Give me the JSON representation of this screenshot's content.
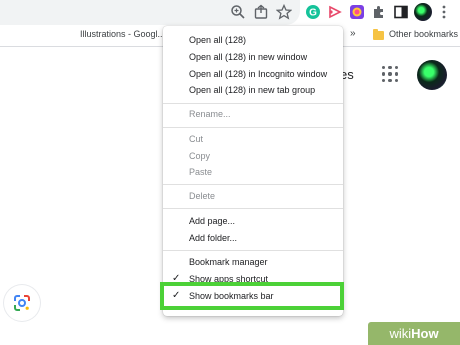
{
  "toolbar": {
    "icons": [
      "zoom-icon",
      "share-icon",
      "star-icon",
      "grammarly-extension-icon",
      "cast-extension-icon",
      "color-extension-icon",
      "extensions-puzzle-icon",
      "sidepanel-icon",
      "profile-avatar",
      "kebab-menu-icon"
    ]
  },
  "bookmarks_bar": {
    "item_partial": "Illustrations - Googl...",
    "overflow": "»",
    "other_bookmarks": "Other bookmarks"
  },
  "page": {
    "partial_text": "es"
  },
  "context_menu": {
    "items": [
      {
        "label": "Open all (128)"
      },
      {
        "label": "Open all (128) in new window"
      },
      {
        "label": "Open all (128) in Incognito window"
      },
      {
        "label": "Open all (128) in new tab group"
      },
      {
        "label": "Rename..."
      },
      {
        "label": "Cut"
      },
      {
        "label": "Copy"
      },
      {
        "label": "Paste"
      },
      {
        "label": "Delete"
      },
      {
        "label": "Add page..."
      },
      {
        "label": "Add folder..."
      },
      {
        "label": "Bookmark manager"
      },
      {
        "label": "Show apps shortcut",
        "checked": true
      },
      {
        "label": "Show bookmarks bar",
        "checked": true
      }
    ]
  },
  "highlight_color": "#4cd137",
  "watermark": {
    "wiki": "wiki",
    "how": "How"
  }
}
